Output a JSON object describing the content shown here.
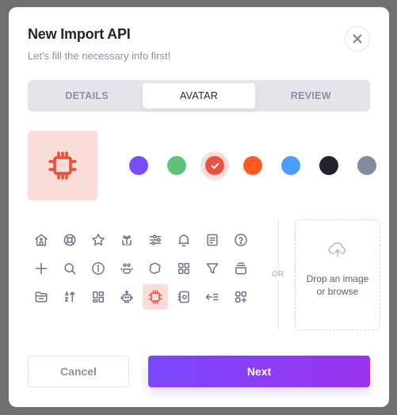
{
  "modal": {
    "title": "New Import API",
    "subtitle": "Let's fill the necessary info first!",
    "close_icon": "close-icon"
  },
  "tabs": [
    {
      "label": "DETAILS",
      "active": false
    },
    {
      "label": "AVATAR",
      "active": true
    },
    {
      "label": "REVIEW",
      "active": false
    }
  ],
  "avatar_preview": {
    "icon": "cpu-icon",
    "color": "#e8533f",
    "background": "#fadcd8"
  },
  "colors": [
    {
      "name": "purple",
      "hex": "#7c4dff",
      "selected": false
    },
    {
      "name": "green",
      "hex": "#5ec27a",
      "selected": false
    },
    {
      "name": "red",
      "hex": "#e8533f",
      "selected": true
    },
    {
      "name": "orange",
      "hex": "#ff5a1f",
      "selected": false
    },
    {
      "name": "blue",
      "hex": "#4a9dff",
      "selected": false
    },
    {
      "name": "black",
      "hex": "#22252d",
      "selected": false
    },
    {
      "name": "gray",
      "hex": "#858a9c",
      "selected": false
    }
  ],
  "icons": [
    {
      "name": "home-icon",
      "selected": false
    },
    {
      "name": "lifebuoy-icon",
      "selected": false
    },
    {
      "name": "star-icon",
      "selected": false
    },
    {
      "name": "gift-icon",
      "selected": false
    },
    {
      "name": "sliders-icon",
      "selected": false
    },
    {
      "name": "bell-icon",
      "selected": false
    },
    {
      "name": "document-icon",
      "selected": false
    },
    {
      "name": "help-circle-icon",
      "selected": false
    },
    {
      "name": "plus-icon",
      "selected": false
    },
    {
      "name": "search-icon",
      "selected": false
    },
    {
      "name": "info-icon",
      "selected": false
    },
    {
      "name": "users-icon",
      "selected": false
    },
    {
      "name": "settings-blob-icon",
      "selected": false
    },
    {
      "name": "grid-icon",
      "selected": false
    },
    {
      "name": "filter-icon",
      "selected": false
    },
    {
      "name": "inbox-stack-icon",
      "selected": false
    },
    {
      "name": "folder-icon",
      "selected": false
    },
    {
      "name": "sort-az-icon",
      "selected": false
    },
    {
      "name": "layout-icon",
      "selected": false
    },
    {
      "name": "robot-icon",
      "selected": false
    },
    {
      "name": "cpu-icon",
      "selected": true
    },
    {
      "name": "notebook-icon",
      "selected": false
    },
    {
      "name": "arrow-left-list-icon",
      "selected": false
    },
    {
      "name": "grid-plus-icon",
      "selected": false
    }
  ],
  "separator_label": "OR",
  "dropzone": {
    "icon": "cloud-upload-icon",
    "line1": "Drop an image",
    "line2": "or browse"
  },
  "footer": {
    "cancel_label": "Cancel",
    "next_label": "Next"
  },
  "theme": {
    "accent_gradient_start": "#7a48fc",
    "accent_gradient_end": "#9a33ef",
    "icon_gray": "#6e7385"
  }
}
